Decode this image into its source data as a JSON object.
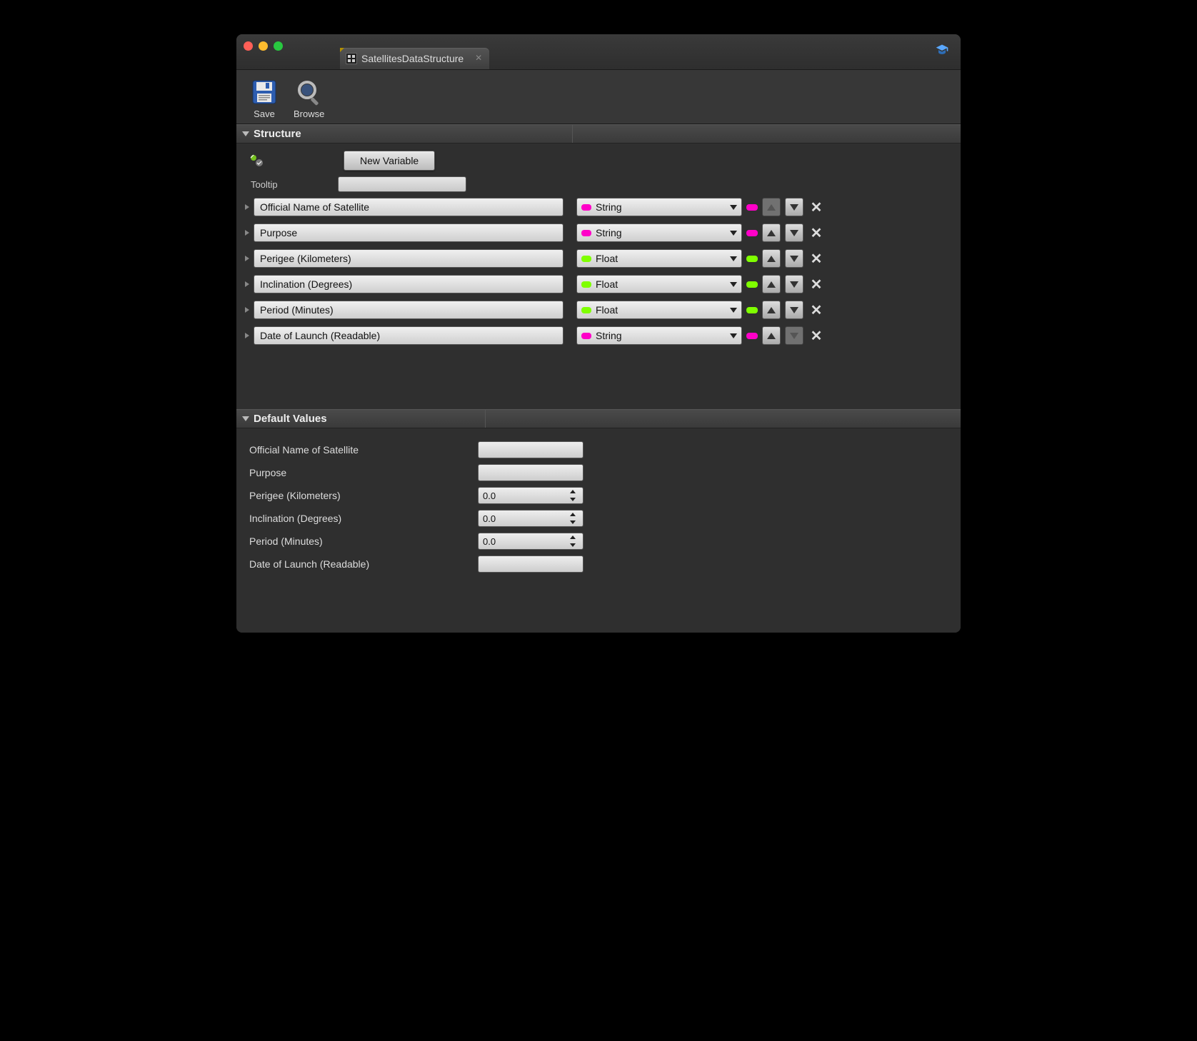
{
  "tab": {
    "title": "SatellitesDataStructure"
  },
  "toolbar": {
    "save_label": "Save",
    "browse_label": "Browse"
  },
  "structure": {
    "header": "Structure",
    "new_variable_label": "New Variable",
    "tooltip_label": "Tooltip",
    "tooltip_value": "",
    "variables": [
      {
        "name": "Official Name of Satellite",
        "type": "String",
        "pill": "string",
        "up_disabled": true,
        "down_disabled": false
      },
      {
        "name": "Purpose",
        "type": "String",
        "pill": "string",
        "up_disabled": false,
        "down_disabled": false
      },
      {
        "name": "Perigee (Kilometers)",
        "type": "Float",
        "pill": "float",
        "up_disabled": false,
        "down_disabled": false
      },
      {
        "name": "Inclination (Degrees)",
        "type": "Float",
        "pill": "float",
        "up_disabled": false,
        "down_disabled": false
      },
      {
        "name": "Period (Minutes)",
        "type": "Float",
        "pill": "float",
        "up_disabled": false,
        "down_disabled": false
      },
      {
        "name": "Date of Launch (Readable)",
        "type": "String",
        "pill": "string",
        "up_disabled": false,
        "down_disabled": true
      }
    ]
  },
  "defaults": {
    "header": "Default Values",
    "rows": [
      {
        "label": "Official Name of Satellite",
        "value": "",
        "numeric": false
      },
      {
        "label": "Purpose",
        "value": "",
        "numeric": false
      },
      {
        "label": "Perigee (Kilometers)",
        "value": "0.0",
        "numeric": true
      },
      {
        "label": "Inclination (Degrees)",
        "value": "0.0",
        "numeric": true
      },
      {
        "label": "Period (Minutes)",
        "value": "0.0",
        "numeric": true
      },
      {
        "label": "Date of Launch (Readable)",
        "value": "",
        "numeric": false
      }
    ]
  }
}
